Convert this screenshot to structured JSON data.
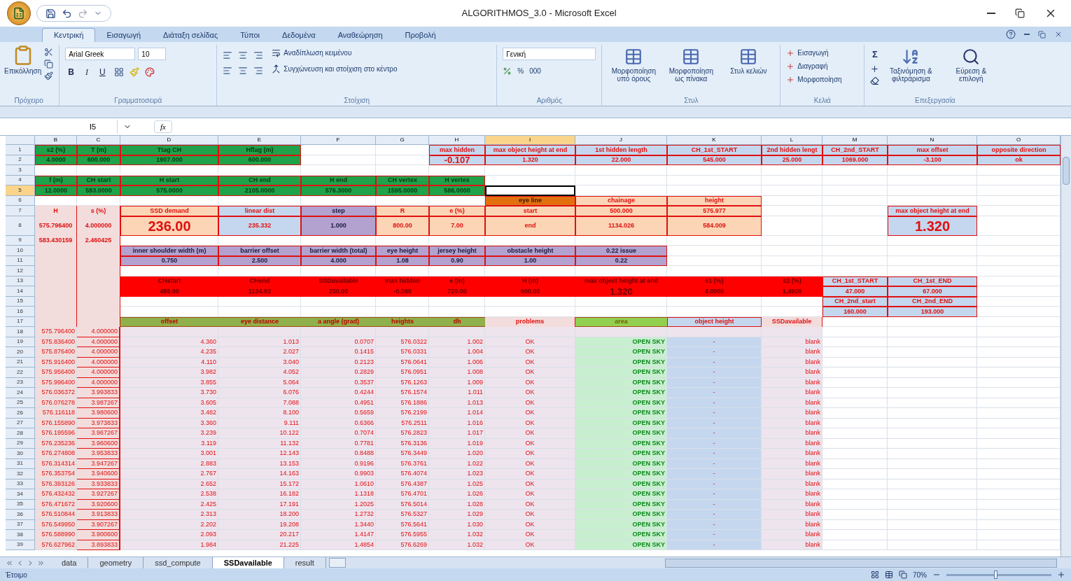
{
  "window": {
    "title": "ALGORITHMOS_3.0 - Microsoft Excel"
  },
  "ribbon": {
    "tabs": [
      {
        "label": "Κεντρική",
        "selected": true
      },
      {
        "label": "Εισαγωγή",
        "selected": false
      },
      {
        "label": "Διάταξη σελίδας",
        "selected": false
      },
      {
        "label": "Τύποι",
        "selected": false
      },
      {
        "label": "Δεδομένα",
        "selected": false
      },
      {
        "label": "Αναθεώρηση",
        "selected": false
      },
      {
        "label": "Προβολή",
        "selected": false
      }
    ],
    "clipboard": {
      "title": "Πρόχειρο",
      "paste": "Επικόλληση"
    },
    "font": {
      "title": "Γραμματοσειρά",
      "font_name": "Arial Greek",
      "font_size": "10",
      "bold": "B",
      "italic": "I",
      "underline": "U"
    },
    "alignment": {
      "title": "Στοίχιση",
      "wrap": "Αναδίπλωση κειμένου",
      "merge": "Συγχώνευση και στοίχιση στο κέντρο"
    },
    "number": {
      "title": "Αριθμός",
      "format": "Γενική",
      "percent": "%",
      "thousands": "000"
    },
    "styles": {
      "title": "Στυλ",
      "buttons": [
        "Μορφοποίηση υπό όρους",
        "Μορφοποίηση ως πίνακα",
        "Στυλ κελιών"
      ]
    },
    "cells": {
      "title": "Κελιά",
      "buttons": [
        "Εισαγωγή",
        "Διαγραφή",
        "Μορφοποίηση"
      ]
    },
    "editing": {
      "title": "Επεξεργασία",
      "sigma": "Σ",
      "buttons": [
        "Ταξινόμηση & φιλτράρισμα",
        "Εύρεση & επιλογή"
      ]
    }
  },
  "formula_bar": {
    "name_box": "I5",
    "function_label": "fx"
  },
  "columns": [
    "B",
    "C",
    "D",
    "E",
    "F",
    "G",
    "H",
    "I",
    "J",
    "K",
    "L",
    "M",
    "N",
    "O"
  ],
  "rows": [
    {
      "number": "1",
      "cells": {
        "B": {
          "text": "s2 (%)",
          "kind": "green"
        },
        "C": {
          "text": "T (m)",
          "kind": "green"
        },
        "D": {
          "text": "Ttag CH",
          "kind": "green"
        },
        "E": {
          "text": "Hflag (m)",
          "kind": "green"
        },
        "H": {
          "text": "max hidden",
          "kind": "blue"
        },
        "I": {
          "text": "max object height at end",
          "kind": "blue"
        },
        "J": {
          "text": "1st hidden length",
          "kind": "blue"
        },
        "K": {
          "text": "CH_1st_START",
          "kind": "blue"
        },
        "L": {
          "text": "2nd hidden lengt",
          "kind": "blue"
        },
        "M": {
          "text": "CH_2nd_START",
          "kind": "blue"
        },
        "N": {
          "text": "max offset",
          "kind": "blue"
        },
        "O": {
          "text": "opposite direction",
          "kind": "blue"
        }
      }
    },
    {
      "number": "2",
      "cells": {
        "B": {
          "text": "4.0000",
          "kind": "green"
        },
        "C": {
          "text": "600.000",
          "kind": "green"
        },
        "D": {
          "text": "1907.000",
          "kind": "green"
        },
        "E": {
          "text": "600.000",
          "kind": "green"
        },
        "H": {
          "text": "-0.107",
          "kind": "blue",
          "emphasis": true
        },
        "I": {
          "text": "1.320",
          "kind": "blue"
        },
        "J": {
          "text": "22.000",
          "kind": "blue"
        },
        "K": {
          "text": "545.000",
          "kind": "blue"
        },
        "L": {
          "text": "25.000",
          "kind": "blue"
        },
        "M": {
          "text": "1069.000",
          "kind": "blue"
        },
        "N": {
          "text": "-3.100",
          "kind": "blue"
        },
        "O": {
          "text": "ok",
          "kind": "blue"
        }
      }
    },
    {
      "number": "3",
      "cells": {}
    },
    {
      "number": "4",
      "cells": {
        "B": {
          "text": "f (m)",
          "kind": "green"
        },
        "C": {
          "text": "CH start",
          "kind": "green"
        },
        "D": {
          "text": "H start",
          "kind": "green"
        },
        "E": {
          "text": "CH end",
          "kind": "green"
        },
        "F": {
          "text": "H end",
          "kind": "green"
        },
        "G": {
          "text": "CH vertex",
          "kind": "green"
        },
        "H": {
          "text": "H vertex",
          "kind": "green"
        }
      }
    },
    {
      "number": "5",
      "cells": {
        "B": {
          "text": "12.0000",
          "kind": "green"
        },
        "C": {
          "text": "583.0000",
          "kind": "green"
        },
        "D": {
          "text": "575.0000",
          "kind": "green"
        },
        "E": {
          "text": "2105.0000",
          "kind": "green"
        },
        "F": {
          "text": "576.3000",
          "kind": "green"
        },
        "G": {
          "text": "1595.0000",
          "kind": "green"
        },
        "H": {
          "text": "586.0000",
          "kind": "green"
        },
        "I": {
          "kind": "plain",
          "selected": true
        }
      }
    },
    {
      "number": "6",
      "cells": {
        "I": {
          "text": "eye line",
          "kind": "orange"
        },
        "J": {
          "text": "chainage",
          "kind": "peach"
        },
        "K": {
          "text": "height",
          "kind": "peach"
        }
      }
    },
    {
      "number": "7",
      "cells": {
        "B": {
          "text": "H",
          "kind": "pink"
        },
        "C": {
          "text": "s (%)",
          "kind": "pink"
        },
        "D": {
          "text": "SSD demand",
          "kind": "peach"
        },
        "E": {
          "text": "linear dist",
          "kind": "blue"
        },
        "F": {
          "text": "step",
          "kind": "lavender"
        },
        "G": {
          "text": "R",
          "kind": "peach"
        },
        "H": {
          "text": "e (%)",
          "kind": "peach"
        },
        "I": {
          "text": "start",
          "kind": "peach"
        },
        "J": {
          "text": "500.000",
          "kind": "peach"
        },
        "K": {
          "text": "575.977",
          "kind": "peach"
        },
        "N": {
          "text": "max object height at end",
          "kind": "blue"
        }
      }
    },
    {
      "number": "8",
      "tall": true,
      "cells": {
        "B": {
          "text": "575.796400",
          "kind": "pink"
        },
        "C": {
          "text": "4.000000",
          "kind": "pink"
        },
        "D": {
          "text": "236.00",
          "kind": "peach",
          "emphasis": true
        },
        "E": {
          "text": "235.332",
          "kind": "blue"
        },
        "F": {
          "text": "1.000",
          "kind": "lavender"
        },
        "G": {
          "text": "800.00",
          "kind": "peach"
        },
        "H": {
          "text": "7.00",
          "kind": "peach"
        },
        "I": {
          "text": "end",
          "kind": "peach"
        },
        "J": {
          "text": "1134.026",
          "kind": "peach"
        },
        "K": {
          "text": "584.009",
          "kind": "peach"
        },
        "N": {
          "text": "1.320",
          "kind": "blue",
          "emphasis": true
        }
      }
    },
    {
      "number": "9",
      "cells": {
        "B": {
          "text": "583.430159",
          "kind": "pink"
        },
        "C": {
          "text": "2.460425",
          "kind": "pink"
        }
      }
    },
    {
      "number": "10",
      "cells": {
        "B": {
          "kind": "pink"
        },
        "C": {
          "kind": "pink"
        },
        "D": {
          "text": "inner shoulder width (m)",
          "kind": "lavender"
        },
        "E": {
          "text": "barrier offset",
          "kind": "lavender"
        },
        "F": {
          "text": "barrier width (total)",
          "kind": "lavender"
        },
        "G": {
          "text": "eye height",
          "kind": "lavender"
        },
        "H": {
          "text": "jersey height",
          "kind": "lavender"
        },
        "I": {
          "text": "obstacle height",
          "kind": "lavender"
        },
        "J": {
          "text": "0.22 issue",
          "kind": "lavender"
        }
      }
    },
    {
      "number": "11",
      "cells": {
        "B": {
          "kind": "pink"
        },
        "C": {
          "kind": "pink"
        },
        "D": {
          "text": "0.750",
          "kind": "lavender"
        },
        "E": {
          "text": "2.500",
          "kind": "lavender"
        },
        "F": {
          "text": "4.000",
          "kind": "lavender"
        },
        "G": {
          "text": "1.08",
          "kind": "lavender"
        },
        "H": {
          "text": "0.90",
          "kind": "lavender"
        },
        "I": {
          "text": "1.00",
          "kind": "lavender"
        },
        "J": {
          "text": "0.22",
          "kind": "lavender"
        }
      }
    },
    {
      "number": "12",
      "cells": {
        "B": {
          "kind": "pink"
        },
        "C": {
          "kind": "pink"
        }
      }
    },
    {
      "number": "13",
      "cells": {
        "B": {
          "kind": "pink"
        },
        "C": {
          "kind": "pink"
        },
        "D": {
          "text": "CHstart",
          "kind": "red"
        },
        "E": {
          "text": "CHend",
          "kind": "red"
        },
        "F": {
          "text": "SSDavailable",
          "kind": "red"
        },
        "G": {
          "text": "max hidden",
          "kind": "red"
        },
        "H": {
          "text": "e (m)",
          "kind": "red"
        },
        "I": {
          "text": "H (m)",
          "kind": "red"
        },
        "J": {
          "text": "max object height at end",
          "kind": "red"
        },
        "K": {
          "text": "s1 (%)",
          "kind": "red"
        },
        "L": {
          "text": "s2 (%)",
          "kind": "red"
        },
        "M": {
          "text": "CH_1st_START",
          "kind": "blue"
        },
        "N": {
          "text": "CH_1st_END",
          "kind": "blue"
        }
      }
    },
    {
      "number": "14",
      "cells": {
        "B": {
          "kind": "pink"
        },
        "C": {
          "kind": "pink"
        },
        "D": {
          "text": "488.00",
          "kind": "red"
        },
        "E": {
          "text": "1134.03",
          "kind": "red"
        },
        "F": {
          "text": "250.00",
          "kind": "red"
        },
        "G": {
          "text": "-0.090",
          "kind": "red"
        },
        "H": {
          "text": "720.00",
          "kind": "red"
        },
        "I": {
          "text": "600.00",
          "kind": "red"
        },
        "J": {
          "text": "1.320",
          "kind": "red",
          "emphasis": true
        },
        "K": {
          "text": "4.0000",
          "kind": "red"
        },
        "L": {
          "text": "1.4600",
          "kind": "red"
        },
        "M": {
          "text": "47.000",
          "kind": "blue"
        },
        "N": {
          "text": "67.000",
          "kind": "blue"
        }
      }
    },
    {
      "number": "15",
      "cells": {
        "B": {
          "kind": "pink"
        },
        "C": {
          "kind": "pink"
        },
        "M": {
          "text": "CH_2nd_start",
          "kind": "blue"
        },
        "N": {
          "text": "CH_2nd_END",
          "kind": "blue"
        }
      }
    },
    {
      "number": "16",
      "cells": {
        "B": {
          "kind": "pink"
        },
        "C": {
          "kind": "pink"
        },
        "M": {
          "text": "160.000",
          "kind": "blue"
        },
        "N": {
          "text": "193.000",
          "kind": "blue"
        }
      }
    },
    {
      "number": "17",
      "cells": {
        "B": {
          "kind": "pink"
        },
        "C": {
          "kind": "pink"
        },
        "D": {
          "text": "offset",
          "kind": "olive"
        },
        "E": {
          "text": "eye distance",
          "kind": "olive"
        },
        "F": {
          "text": "a angle (grad)",
          "kind": "olive"
        },
        "G": {
          "text": "heights",
          "kind": "olive"
        },
        "H": {
          "text": "dh",
          "kind": "olive"
        },
        "I": {
          "text": "problems",
          "kind": "pink"
        },
        "J": {
          "text": "area",
          "kind": "lime"
        },
        "K": {
          "text": "object height",
          "kind": "blue"
        },
        "L": {
          "text": "SSDavailable",
          "kind": "pink"
        }
      }
    }
  ],
  "data_rows": [
    {
      "number": "18",
      "values": [
        "575.796400",
        "4.000000"
      ]
    },
    {
      "number": "19",
      "values": [
        "575.836400",
        "4.000000",
        "4.360",
        "1.013",
        "0.0707",
        "576.0322",
        "1.002",
        "OK",
        "OPEN SKY",
        "-",
        "blank"
      ]
    },
    {
      "number": "20",
      "values": [
        "575.876400",
        "4.000000",
        "4.235",
        "2.027",
        "0.1415",
        "576.0331",
        "1.004",
        "OK",
        "OPEN SKY",
        "-",
        "blank"
      ]
    },
    {
      "number": "21",
      "values": [
        "575.916400",
        "4.000000",
        "4.110",
        "3.040",
        "0.2123",
        "576.0641",
        "1.006",
        "OK",
        "OPEN SKY",
        "-",
        "blank"
      ]
    },
    {
      "number": "22",
      "values": [
        "575.956400",
        "4.000000",
        "3.982",
        "4.052",
        "0.2829",
        "576.0951",
        "1.008",
        "OK",
        "OPEN SKY",
        "-",
        "blank"
      ]
    },
    {
      "number": "23",
      "values": [
        "575.996400",
        "4.000000",
        "3.855",
        "5.064",
        "0.3537",
        "576.1263",
        "1.009",
        "OK",
        "OPEN SKY",
        "-",
        "blank"
      ]
    },
    {
      "number": "24",
      "values": [
        "576.036372",
        "3.993833",
        "3.730",
        "6.076",
        "0.4244",
        "576.1574",
        "1.011",
        "OK",
        "OPEN SKY",
        "-",
        "blank"
      ]
    },
    {
      "number": "25",
      "values": [
        "576.076278",
        "3.987267",
        "3.605",
        "7.088",
        "0.4951",
        "576.1886",
        "1.013",
        "OK",
        "OPEN SKY",
        "-",
        "blank"
      ]
    },
    {
      "number": "26",
      "values": [
        "576.116118",
        "3.980600",
        "3.482",
        "8.100",
        "0.5659",
        "576.2199",
        "1.014",
        "OK",
        "OPEN SKY",
        "-",
        "blank"
      ]
    },
    {
      "number": "27",
      "values": [
        "576.155890",
        "3.973833",
        "3.360",
        "9.111",
        "0.6366",
        "576.2511",
        "1.016",
        "OK",
        "OPEN SKY",
        "-",
        "blank"
      ]
    },
    {
      "number": "28",
      "values": [
        "576.195596",
        "3.967267",
        "3.239",
        "10.122",
        "0.7074",
        "576.2823",
        "1.017",
        "OK",
        "OPEN SKY",
        "-",
        "blank"
      ]
    },
    {
      "number": "29",
      "values": [
        "576.235236",
        "3.960600",
        "3.119",
        "11.132",
        "0.7781",
        "576.3136",
        "1.019",
        "OK",
        "OPEN SKY",
        "-",
        "blank"
      ]
    },
    {
      "number": "30",
      "values": [
        "576.274808",
        "3.953833",
        "3.001",
        "12.143",
        "0.8488",
        "576.3449",
        "1.020",
        "OK",
        "OPEN SKY",
        "-",
        "blank"
      ]
    },
    {
      "number": "31",
      "values": [
        "576.314314",
        "3.947267",
        "2.883",
        "13.153",
        "0.9196",
        "576.3761",
        "1.022",
        "OK",
        "OPEN SKY",
        "-",
        "blank"
      ]
    },
    {
      "number": "32",
      "values": [
        "576.353754",
        "3.940600",
        "2.767",
        "14.163",
        "0.9903",
        "576.4074",
        "1.023",
        "OK",
        "OPEN SKY",
        "-",
        "blank"
      ]
    },
    {
      "number": "33",
      "values": [
        "576.393126",
        "3.933833",
        "2.652",
        "15.172",
        "1.0610",
        "576.4387",
        "1.025",
        "OK",
        "OPEN SKY",
        "-",
        "blank"
      ]
    },
    {
      "number": "34",
      "values": [
        "576.432432",
        "3.927267",
        "2.538",
        "16.182",
        "1.1318",
        "576.4701",
        "1.026",
        "OK",
        "OPEN SKY",
        "-",
        "blank"
      ]
    },
    {
      "number": "35",
      "values": [
        "576.471672",
        "3.920600",
        "2.425",
        "17.191",
        "1.2025",
        "576.5014",
        "1.028",
        "OK",
        "OPEN SKY",
        "-",
        "blank"
      ]
    },
    {
      "number": "36",
      "values": [
        "576.510844",
        "3.913833",
        "2.313",
        "18.200",
        "1.2732",
        "576.5327",
        "1.029",
        "OK",
        "OPEN SKY",
        "-",
        "blank"
      ]
    },
    {
      "number": "37",
      "values": [
        "576.549950",
        "3.907267",
        "2.202",
        "19.208",
        "1.3440",
        "576.5641",
        "1.030",
        "OK",
        "OPEN SKY",
        "-",
        "blank"
      ]
    },
    {
      "number": "38",
      "values": [
        "576.588990",
        "3.900600",
        "2.093",
        "20.217",
        "1.4147",
        "576.5955",
        "1.032",
        "OK",
        "OPEN SKY",
        "-",
        "blank"
      ]
    },
    {
      "number": "39",
      "values": [
        "576.627962",
        "3.893833",
        "1.984",
        "21.225",
        "1.4854",
        "576.6269",
        "1.032",
        "OK",
        "OPEN SKY",
        "-",
        "blank"
      ]
    }
  ],
  "sheet_tabs": [
    {
      "label": "data",
      "selected": false
    },
    {
      "label": "geometry",
      "selected": false
    },
    {
      "label": "ssd_compute",
      "selected": false
    },
    {
      "label": "SSDavailable",
      "selected": true
    },
    {
      "label": "result",
      "selected": false
    }
  ],
  "status_bar": {
    "text": "Έτοιμο",
    "zoom": "70%",
    "zoom_slider": {
      "level": 0.45
    }
  }
}
